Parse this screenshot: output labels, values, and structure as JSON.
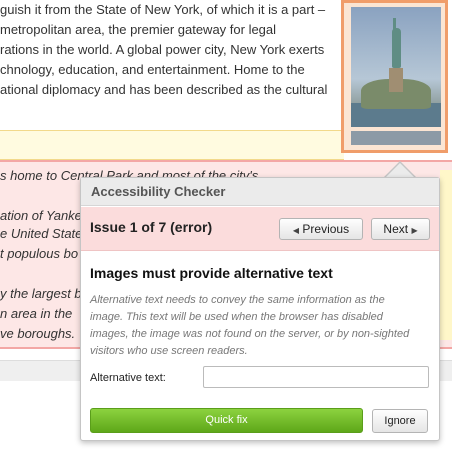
{
  "document": {
    "top_lines": [
      "guish it from the State of New York, of which it is a part –",
      "metropolitan area, the premier gateway for legal",
      "rations in the world. A global power city, New York exerts",
      "chnology, education, and entertainment. Home to the",
      "ational diplomacy and has been described as the cultural"
    ],
    "bottom_lines": [
      "s home to Central Park and most of the city's",
      "ation of Yanke",
      "e United State",
      "t populous bo",
      "y the largest b",
      "n area in the",
      "ve boroughs."
    ]
  },
  "balloon": {
    "title": "Accessibility Checker",
    "issue_count": "Issue 1 of 7 (error)",
    "prev_label": "Previous",
    "next_label": "Next",
    "issue_title": "Images must provide alternative text",
    "issue_description": "Alternative text needs to convey the same information as the image. This text will be used when the browser has disabled images, the image was not found on the server, or by non-sighted visitors who use screen readers.",
    "alt_text_label": "Alternative text:",
    "alt_text_value": "",
    "quickfix_label": "Quick fix",
    "ignore_label": "Ignore"
  },
  "colors": {
    "quickfix_green": "#6bb52a",
    "issue_bar": "#fbdcdc",
    "image_border": "#f09d6a",
    "highlight_pink": "#fde7e6",
    "highlight_yellow": "#fffbe0"
  }
}
